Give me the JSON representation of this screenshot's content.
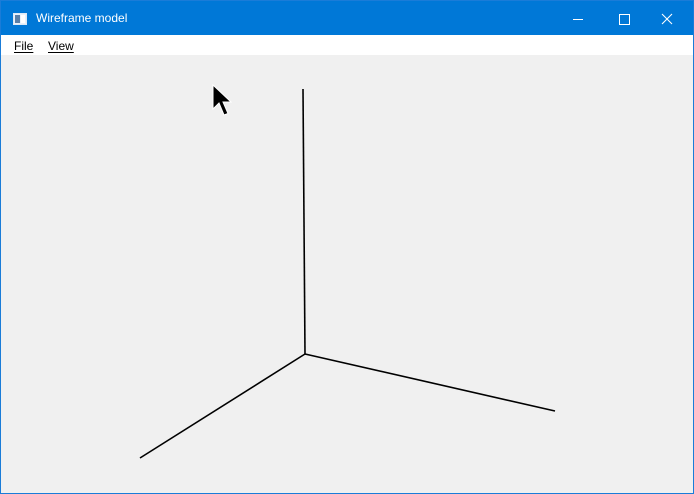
{
  "window": {
    "title": "Wireframe model",
    "icon": "app-window-icon",
    "title_bar_color": "#0078d7",
    "controls": {
      "minimize_icon": "minimize-icon",
      "maximize_icon": "maximize-icon",
      "close_icon": "close-icon"
    }
  },
  "menu": {
    "items": [
      {
        "label": "File"
      },
      {
        "label": "View"
      }
    ]
  },
  "canvas": {
    "background": "#f0f0f0",
    "content": "wireframe-axes",
    "line_color": "#000000",
    "cursor": "mouse-pointer-icon"
  }
}
